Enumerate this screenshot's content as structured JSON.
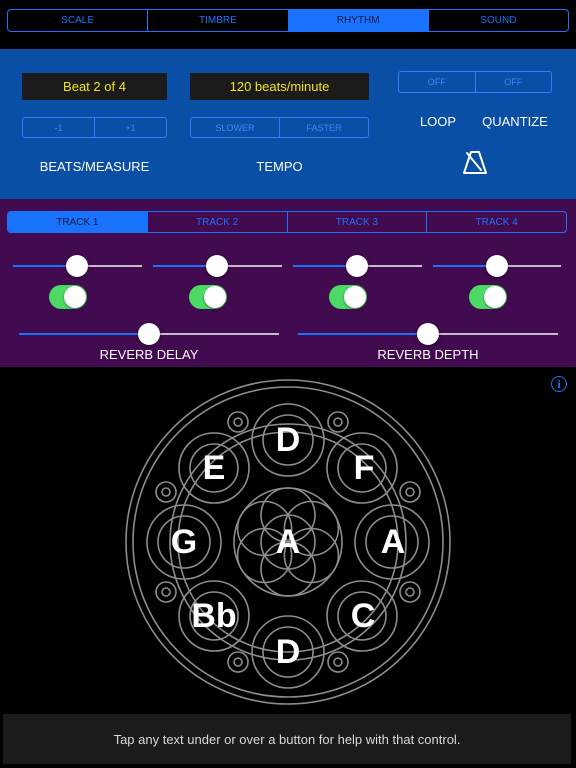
{
  "top_tabs": [
    {
      "label": "SCALE",
      "selected": false
    },
    {
      "label": "TIMBRE",
      "selected": false
    },
    {
      "label": "RHYTHM",
      "selected": true
    },
    {
      "label": "SOUND",
      "selected": false
    }
  ],
  "beats": {
    "display": "Beat 2 of 4",
    "minus_label": "-1",
    "plus_label": "+1",
    "caption": "BEATS/MEASURE"
  },
  "tempo": {
    "display": "120 beats/minute",
    "slower_label": "SLOWER",
    "faster_label": "FASTER",
    "caption": "TEMPO"
  },
  "loop": {
    "state_label": "OFF",
    "caption": "LOOP"
  },
  "quantize": {
    "state_label": "OFF",
    "caption": "QUANTIZE"
  },
  "metronome_icon": "metronome-icon",
  "tracks": [
    {
      "label": "TRACK 1",
      "selected": true,
      "volume": 0.5,
      "enabled": true
    },
    {
      "label": "TRACK 2",
      "selected": false,
      "volume": 0.5,
      "enabled": true
    },
    {
      "label": "TRACK 3",
      "selected": false,
      "volume": 0.5,
      "enabled": true
    },
    {
      "label": "TRACK 4",
      "selected": false,
      "volume": 0.5,
      "enabled": true
    }
  ],
  "reverb_delay": {
    "label": "REVERB DELAY",
    "value": 0.5
  },
  "reverb_depth": {
    "label": "REVERB DEPTH",
    "value": 0.5
  },
  "drum_notes": {
    "center": "A",
    "top": "D",
    "upper_right": "F",
    "right": "A",
    "lower_right": "C",
    "bottom": "D",
    "lower_left": "Bb",
    "left": "G",
    "upper_left": "E"
  },
  "info_icon": "info-icon",
  "info_glyph": "i",
  "help_text": "Tap any text under or over a button for help with that control.",
  "colors": {
    "accent": "#1a73ff",
    "blue_panel": "#0a4fa6",
    "purple_panel": "#420a4f",
    "display_text": "#f2e31a",
    "toggle_on": "#4cd964"
  }
}
